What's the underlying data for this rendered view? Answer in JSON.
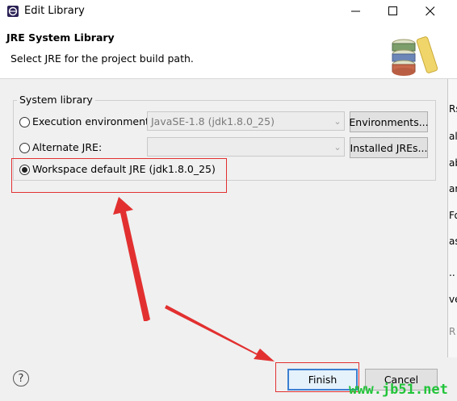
{
  "window": {
    "title": "Edit Library",
    "min_icon": "minimize-icon",
    "max_icon": "maximize-icon",
    "close_icon": "close-icon"
  },
  "header": {
    "title": "JRE System Library",
    "subtitle": "Select JRE for the project build path.",
    "icon": "library-books-icon"
  },
  "group": {
    "label": "System library",
    "options": [
      {
        "label": "Execution environment:",
        "checked": false,
        "combo_value": "JavaSE-1.8 (jdk1.8.0_25)",
        "button": "Environments..."
      },
      {
        "label": "Alternate JRE:",
        "checked": false,
        "combo_value": "",
        "button": "Installed JREs..."
      },
      {
        "label": "Workspace default JRE (jdk1.8.0_25)",
        "checked": true
      }
    ]
  },
  "right_panel": {
    "fragments": [
      "Rs",
      "al",
      "ab",
      "ar",
      "Fo",
      "as",
      "..",
      "ve",
      "R"
    ]
  },
  "footer": {
    "help_icon": "help-icon",
    "finish": "Finish",
    "cancel": "Cancel"
  },
  "overlay": {
    "watermark": "www.jb51.net",
    "annotation_color": "#e23030",
    "watermark_color": "#22c43a"
  }
}
